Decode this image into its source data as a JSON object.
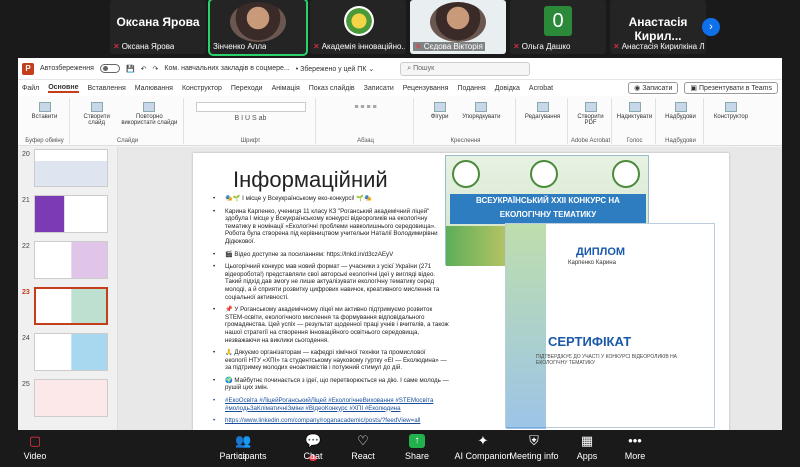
{
  "participants": [
    {
      "big": "Оксана Ярова",
      "name": "Оксана Ярова",
      "kind": "text"
    },
    {
      "big": "",
      "name": "Зінченко Алла",
      "kind": "face",
      "active": true
    },
    {
      "big": "",
      "name": "Академія інноваційно...",
      "kind": "logo"
    },
    {
      "big": "",
      "name": "Сєдова Вікторія",
      "kind": "face-light"
    },
    {
      "big": "0",
      "name": "Ольга Дашко",
      "kind": "green"
    },
    {
      "big": "Анастасія  Кирил...",
      "name": "Анастасія Кирилкіна Л...",
      "kind": "text"
    }
  ],
  "ppt": {
    "autosave": "Автозбереження",
    "doc": "Ком. навчальних закладів в соцмере...",
    "saved": "• Збережено у цей ПК ⌄",
    "search": "Пошук",
    "tabs": [
      "Файл",
      "Основне",
      "Вставлення",
      "Малювання",
      "Конструктор",
      "Переходи",
      "Анімація",
      "Показ слайдів",
      "Записати",
      "Рецензування",
      "Подання",
      "Довідка",
      "Acrobat"
    ],
    "record": "Записати",
    "present_teams": "Презентувати в Teams",
    "groups": [
      "Буфер обміну",
      "Слайди",
      "Шрифт",
      "Абзац",
      "Креслення",
      "Редагування",
      "Adobe Acrobat",
      "Голос",
      "Надбудови",
      "Конструктор"
    ],
    "ribbon_buttons": [
      "Вставити",
      "Створити слайд",
      "Повторно використати слайди",
      "Фігури",
      "Упорядкувати",
      "Редагування",
      "Створити PDF",
      "Надиктувати",
      "Надбудови",
      "Конструктор"
    ],
    "thumb_nums": [
      "20",
      "21",
      "22",
      "23",
      "24",
      "25"
    ],
    "selected_thumb": "23"
  },
  "slide": {
    "title": "Інформаційний",
    "bullets": [
      "🎭🌱 І місце у Всеукраїнському еко-конкурсі! 🌱🎭",
      "Карина Карпенко, учениця 11 класу КЗ \"Роганський академічний ліцей\" здобула І місце у Всеукраїнському конкурсі відеороликів на екологічну тематику в номінації «Екологічні проблеми навколишнього середовища». Робота була створена під керівництвом учительки Наталії Володимирівни Дідюкової.",
      "🎬 Відео доступне за посиланням: https://lnkd.in/d3czAEyV",
      "Цьогорічний конкурс мав новий формат — учасники з усієї України (271 відеоробота!) представляли свої авторські екологічні ідеї у вигляді відео. Такий підхід дав змогу не лише актуалізувати екологічну тематику серед молоді, а й сприяти розвитку цифрових навичок, креативного мислення та соціальної активності.",
      "📌 У Роганському академічному ліцеї ми активно підтримуємо розвиток STEM-освіти, екологічного мислення та формування відповідального громадянства. Цей успіх — результат щоденної праці учнів і вчителів, а також нашої стратегії на створення інноваційного освітнього середовища, незважаючи на виклики сьогодення.",
      "🙏 Дякуємо організаторам — кафедрі хімічної техніки та промислової екології НТУ «ХПІ» та студентському науковому гуртку «ЕІ — Еколюдина» — за підтримку молодих еноактивістів і потужний стимул до дій.",
      "🌍 Майбутнє починається з ідеї, що перетворюється на дію. І саме молодь — рушій цих змін.",
      "#ЕкоОсвіта #ЛіцейРоганськийЛіцей #ЕкологічнеВиховання #STEMосвіта #молодьЗаКліматичніЗміни #ВідеоКонкурс #ХПІ #Еколюдина",
      "https://www.linkedin.com/company/roganacademic/posts/?feedView=all"
    ],
    "banner": "ВСЕУКРАЇНСЬКИЙ ХХІІ КОНКУРС НА ЕКОЛОГІЧНУ ТЕМАТИКУ",
    "diploma": "ДИПЛОМ",
    "diploma_name": "Карпенко Карина",
    "certificate": "СЕРТИФІКАТ",
    "cert_text": "ПІДТВЕРДЖУЄ ДО УЧАСТІ У КОНКУРСІ ВІДЕОРОЛИКІВ НА ЕКОЛОГІЧНУ ТЕМАТИКУ"
  },
  "bar": {
    "video": "Video",
    "participants": "Participants",
    "participants_count": "13",
    "chat": "Chat",
    "chat_badge": "1",
    "react": "React",
    "share": "Share",
    "companion": "AI Companion",
    "meeting": "Meeting info",
    "apps": "Apps",
    "more": "More"
  }
}
